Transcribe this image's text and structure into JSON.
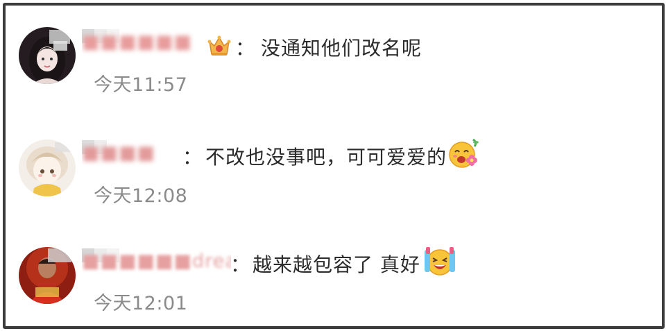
{
  "comments": [
    {
      "username": "■■■■■■",
      "badge_icon": "crown-badge-icon",
      "separator": "：",
      "text": "没通知他们改名呢",
      "time": "今天11:57",
      "colors": {
        "avatar_bg": "#2a2024",
        "name_tint": "#e7a2a2"
      }
    },
    {
      "username": "■■■■",
      "separator": "：",
      "text": "不改也没事吧，可可爱爱的",
      "emoji_icon": "flower-blushing-face-emoji-icon",
      "time": "今天12:08",
      "colors": {
        "avatar_bg": "#f3ece4",
        "name_tint": "#e7a2a2"
      }
    },
    {
      "username": "■■■■■■dream",
      "separator": "：",
      "text": "越来越包容了 真好",
      "emoji_icon": "crying-laughing-face-emoji-icon",
      "time": "今天12:01",
      "colors": {
        "avatar_bg": "#a8261a",
        "name_tint": "#e7a2a2"
      }
    }
  ]
}
